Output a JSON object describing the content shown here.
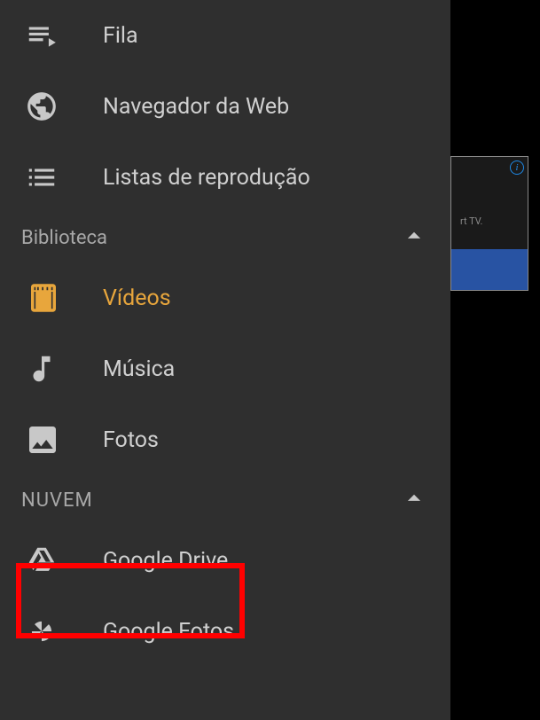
{
  "nav": {
    "items": [
      {
        "label": "Fila",
        "icon": "queue"
      },
      {
        "label": "Navegador da Web",
        "icon": "globe"
      },
      {
        "label": "Listas de reprodução",
        "icon": "playlist"
      }
    ]
  },
  "sections": {
    "library": {
      "title": "Biblioteca",
      "items": [
        {
          "label": "Vídeos",
          "icon": "video",
          "active": true
        },
        {
          "label": "Música",
          "icon": "music"
        },
        {
          "label": "Fotos",
          "icon": "photos"
        }
      ]
    },
    "cloud": {
      "title": "NUVEM",
      "items": [
        {
          "label": "Google Drive",
          "icon": "drive"
        },
        {
          "label": "Google Fotos",
          "icon": "gphotos"
        }
      ]
    }
  },
  "bg_peek_text": "rt TV."
}
